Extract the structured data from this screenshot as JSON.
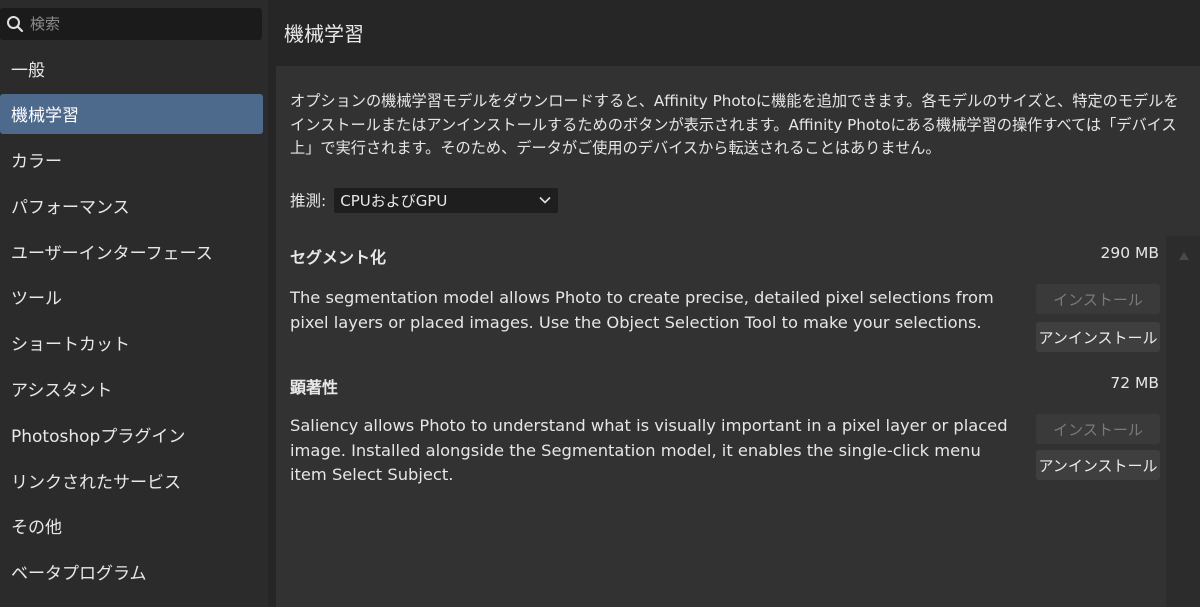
{
  "search": {
    "placeholder": "検索"
  },
  "sidebar": {
    "items": [
      {
        "label": "一般"
      },
      {
        "label": "機械学習"
      },
      {
        "label": "カラー"
      },
      {
        "label": "パフォーマンス"
      },
      {
        "label": "ユーザーインターフェース"
      },
      {
        "label": "ツール"
      },
      {
        "label": "ショートカット"
      },
      {
        "label": "アシスタント"
      },
      {
        "label": "Photoshopプラグイン"
      },
      {
        "label": "リンクされたサービス"
      },
      {
        "label": "その他"
      },
      {
        "label": "ベータプログラム"
      }
    ],
    "active_index": 1
  },
  "header": {
    "title": "機械学習"
  },
  "main": {
    "intro": "オプションの機械学習モデルをダウンロードすると、Affinity Photoに機能を追加できます。各モデルのサイズと、特定のモデルをインストールまたはアンインストールするためのボタンが表示されます。Affinity Photoにある機械学習の操作すべては「デバイス上」で実行されます。そのため、データがご使用のデバイスから転送されることはありません。",
    "inference": {
      "label": "推測:",
      "selected": "CPUおよびGPU"
    },
    "models": [
      {
        "name": "セグメント化",
        "size": "290 MB",
        "description": "The segmentation model allows Photo to create precise, detailed pixel selections from pixel layers or placed images. Use the Object Selection Tool to make your selections.",
        "install_label": "インストール",
        "uninstall_label": "アンインストール"
      },
      {
        "name": "顕著性",
        "size": "72 MB",
        "description": "Saliency allows Photo to understand what is visually important in a pixel layer or placed image. Installed alongside the Segmentation model, it enables the single-click menu item Select Subject.",
        "install_label": "インストール",
        "uninstall_label": "アンインストール"
      }
    ]
  },
  "colors": {
    "window_bg": "#262626",
    "sidebar_bg": "#2b2b2b",
    "panel_bg": "#323232",
    "active_item": "#4d6a8c",
    "text": "#e6e6e6",
    "disabled_text": "#7a7a7a"
  },
  "icons": {
    "search": "search-icon",
    "dropdown": "chevron-down-icon",
    "scroll_up": "scroll-up-arrow-icon"
  }
}
